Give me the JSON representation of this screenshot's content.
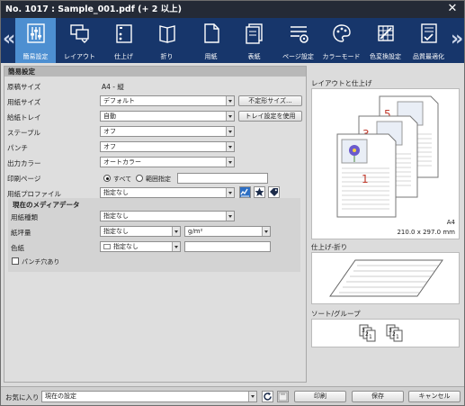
{
  "window": {
    "title": "No. 1017 : Sample_001.pdf (+ 2 以上)",
    "close": "✕"
  },
  "tabs": [
    {
      "label": "簡易設定",
      "icon": "sliders-icon",
      "active": true
    },
    {
      "label": "レイアウト",
      "icon": "layout-icon"
    },
    {
      "label": "仕上げ",
      "icon": "finishing-icon"
    },
    {
      "label": "折り",
      "icon": "fold-icon"
    },
    {
      "label": "用紙",
      "icon": "paper-icon"
    },
    {
      "label": "表紙",
      "icon": "cover-icon"
    },
    {
      "label": "ページ設定",
      "icon": "page-settings-icon"
    },
    {
      "label": "カラーモード",
      "icon": "color-mode-icon"
    },
    {
      "label": "色変換設定",
      "icon": "color-conversion-icon"
    },
    {
      "label": "品質最適化",
      "icon": "quality-icon"
    }
  ],
  "nav": {
    "prev": "«",
    "next": "»"
  },
  "basic": {
    "header": "簡易設定",
    "original_size_label": "原稿サイズ",
    "original_size_value": "A4 - 縦",
    "paper_size_label": "用紙サイズ",
    "paper_size_value": "デフォルト",
    "irregular_button": "不定形サイズ...",
    "tray_label": "給紙トレイ",
    "tray_value": "自動",
    "tray_button": "トレイ設定を使用",
    "staple_label": "ステープル",
    "staple_value": "オフ",
    "punch_label": "パンチ",
    "punch_value": "オフ",
    "color_label": "出力カラー",
    "color_value": "オートカラー",
    "print_pages_label": "印刷ページ",
    "all_label": "すべて",
    "range_label": "範囲指定",
    "profile_label": "用紙プロファイル",
    "profile_value": "指定なし"
  },
  "media": {
    "header": "現在のメディアデータ",
    "type_label": "用紙種類",
    "type_value": "指定なし",
    "weight_label": "紙坪量",
    "weight_value": "指定なし",
    "weight_unit": "g/m²",
    "color_label": "色紙",
    "color_value": "指定なし",
    "prepunched_label": "パンチ穴あり"
  },
  "preview": {
    "layout_label": "レイアウトと仕上げ",
    "page_numbers": [
      "5",
      "3",
      "1"
    ],
    "size_name": "A4",
    "size_dims": "210.0 x 297.0 mm",
    "fold_label": "仕上げ-折り",
    "sort_label": "ソート/グループ",
    "sort_digits": [
      "1",
      "2",
      "3"
    ]
  },
  "footer": {
    "favorites_label": "お気に入り",
    "favorites_value": "現在の設定",
    "print_button": "印刷",
    "save_button": "保存",
    "cancel_button": "キャンセル"
  }
}
